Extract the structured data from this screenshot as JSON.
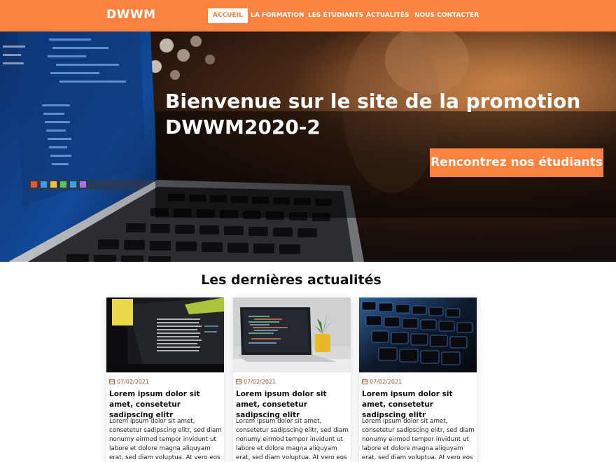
{
  "nav": {
    "brand": "DWWM",
    "items": [
      {
        "label": "ACCUEIL"
      },
      {
        "label": "LA FORMATION"
      },
      {
        "label": "LES ÉTUDIANTS"
      },
      {
        "label": "ACTUALITÉS"
      },
      {
        "label": "NOUS CONTACTER"
      }
    ]
  },
  "hero": {
    "title": "Bienvenue sur le site de la promotion DWWM2020-2",
    "cta": "Rencontrez nos étudiants"
  },
  "news": {
    "heading": "Les dernières actualités",
    "cards": [
      {
        "date": "07/02/2021",
        "title": "Lorem ipsum dolor sit amet, consetetur sadipscing elitr",
        "text": "Lorem ipsum dolor sit amet, consetetur sadipscing elitr, sed diam nonumy eirmod tempor invidunt ut labore et dolore magna aliquyam erat, sed diam voluptua. At vero eos"
      },
      {
        "date": "07/02/2021",
        "title": "Lorem ipsum dolor sit amet, consetetur sadipscing elitr",
        "text": "Lorem ipsum dolor sit amet, consetetur sadipscing elitr, sed diam nonumy eirmod tempor invidunt ut labore et dolore magna aliquyam erat, sed diam voluptua. At vero eos"
      },
      {
        "date": "07/02/2021",
        "title": "Lorem ipsum dolor sit amet, consetetur sadipscing elitr",
        "text": "Lorem ipsum dolor sit amet, consetetur sadipscing elitr, sed diam nonumy eirmod tempor invidunt ut labore et dolore magna aliquyam erat, sed diam voluptua. At vero eos"
      }
    ]
  },
  "colors": {
    "accent": "#fb823f",
    "date": "#a0542c"
  },
  "icons": {
    "date": "calendar-icon"
  }
}
